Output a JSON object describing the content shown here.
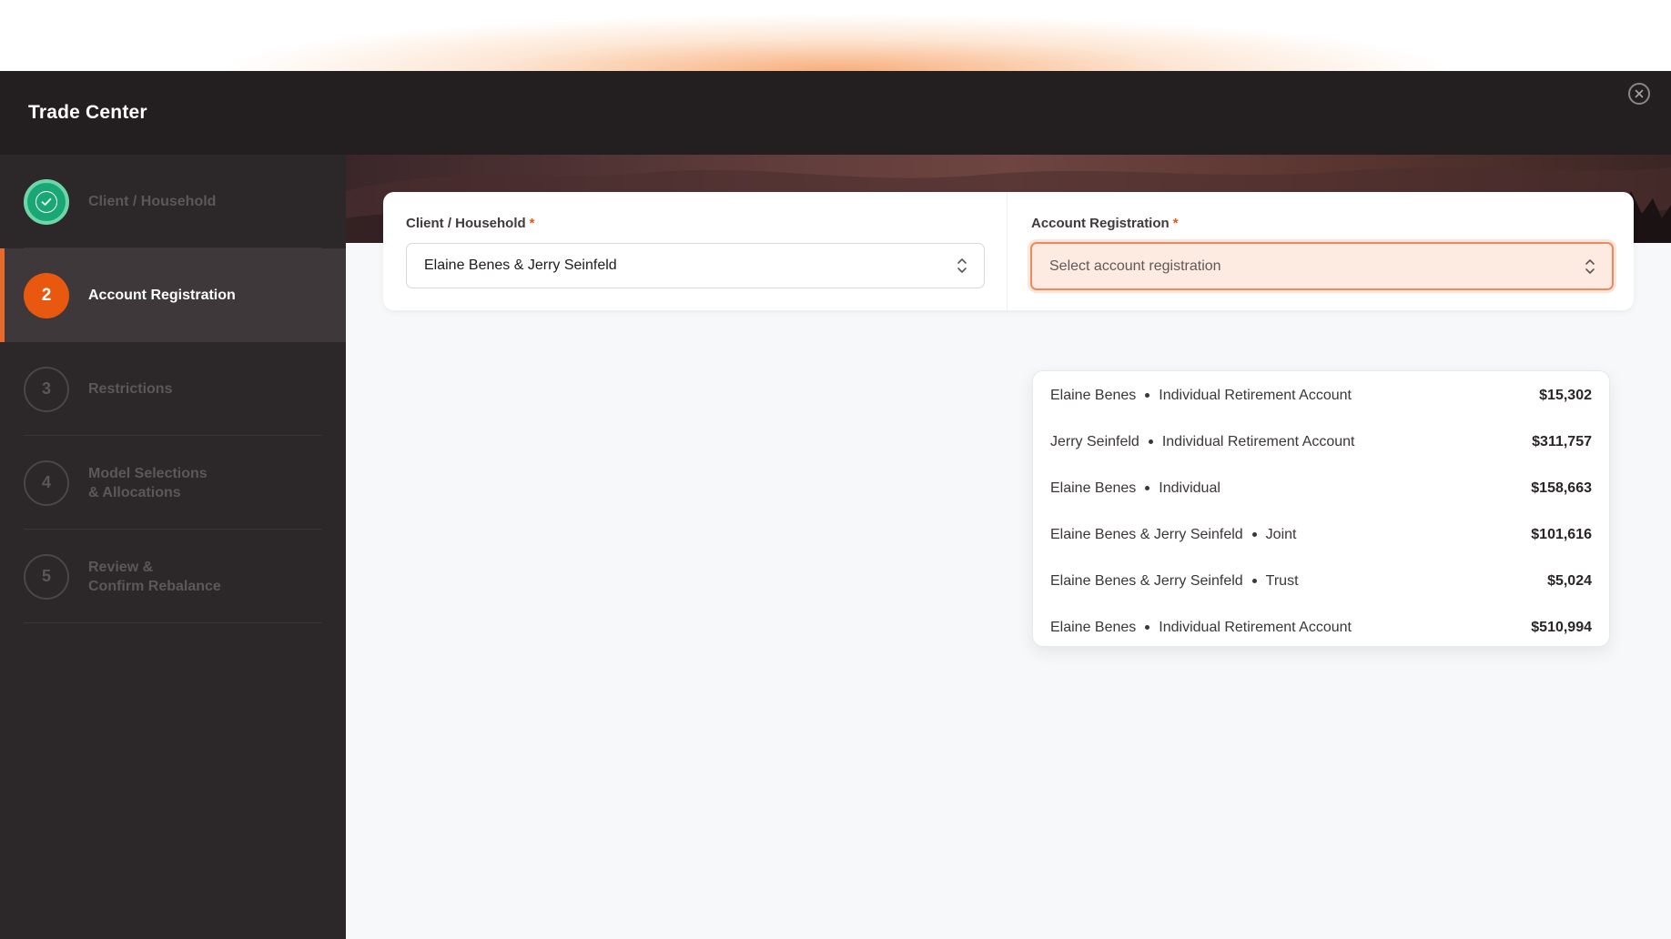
{
  "header": {
    "title": "Trade Center"
  },
  "steps": [
    {
      "number": "",
      "label_line1": "Client / Household",
      "label_line2": "",
      "state": "done"
    },
    {
      "number": "2",
      "label_line1": "Account Registration",
      "label_line2": "",
      "state": "active"
    },
    {
      "number": "3",
      "label_line1": "Restrictions",
      "label_line2": "",
      "state": "pending"
    },
    {
      "number": "4",
      "label_line1": "Model Selections",
      "label_line2": "& Allocations",
      "state": "pending"
    },
    {
      "number": "5",
      "label_line1": "Review &",
      "label_line2": "Confirm Rebalance",
      "state": "pending"
    }
  ],
  "form": {
    "client_label": "Client / Household",
    "client_value": "Elaine Benes & Jerry Seinfeld",
    "account_label": "Account Registration",
    "account_placeholder": "Select account registration",
    "required_mark": "*"
  },
  "dropdown": {
    "options": [
      {
        "owner": "Elaine Benes",
        "type": "Individual Retirement Account",
        "amount": "$15,302"
      },
      {
        "owner": "Jerry Seinfeld",
        "type": "Individual Retirement Account",
        "amount": "$311,757"
      },
      {
        "owner": "Elaine Benes",
        "type": "Individual",
        "amount": "$158,663"
      },
      {
        "owner": "Elaine Benes & Jerry Seinfeld",
        "type": "Joint",
        "amount": "$101,616"
      },
      {
        "owner": "Elaine Benes & Jerry Seinfeld",
        "type": "Trust",
        "amount": "$5,024"
      },
      {
        "owner": "Elaine Benes",
        "type": "Individual Retirement Account",
        "amount": "$510,994"
      }
    ]
  },
  "colors": {
    "accent": "#e8580f",
    "success": "#1aa776",
    "header_bg": "#231e20",
    "sidebar_bg": "#2c2729"
  },
  "icons": [
    "close-icon",
    "check-icon",
    "chevron-up-down-icon"
  ]
}
